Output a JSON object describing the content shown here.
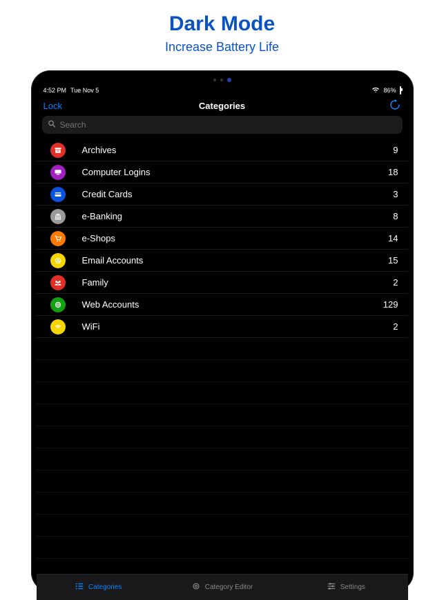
{
  "promo": {
    "title": "Dark Mode",
    "subtitle": "Increase Battery Life"
  },
  "status": {
    "time": "4:52 PM",
    "date": "Tue Nov 5",
    "battery_pct": "86%"
  },
  "nav": {
    "left": "Lock",
    "title": "Categories",
    "right_icon": "refresh"
  },
  "search": {
    "placeholder": "Search",
    "value": ""
  },
  "categories": [
    {
      "icon": "archive",
      "color": "#e22f27",
      "label": "Archives",
      "count": 9
    },
    {
      "icon": "computer",
      "color": "#a020c0",
      "label": "Computer Logins",
      "count": 18
    },
    {
      "icon": "card",
      "color": "#0a52e0",
      "label": "Credit Cards",
      "count": 3
    },
    {
      "icon": "bank",
      "color": "#9a9a9a",
      "label": "e-Banking",
      "count": 8
    },
    {
      "icon": "cart",
      "color": "#ff7a00",
      "label": "e-Shops",
      "count": 14
    },
    {
      "icon": "at",
      "color": "#f5d400",
      "label": "Email Accounts",
      "count": 15
    },
    {
      "icon": "family",
      "color": "#e22f27",
      "label": "Family",
      "count": 2
    },
    {
      "icon": "globe",
      "color": "#12a012",
      "label": "Web Accounts",
      "count": 129
    },
    {
      "icon": "wifi",
      "color": "#f5d400",
      "label": "WiFi",
      "count": 2
    }
  ],
  "tabs": [
    {
      "icon": "list",
      "label": "Categories",
      "active": true
    },
    {
      "icon": "gear",
      "label": "Category Editor",
      "active": false
    },
    {
      "icon": "sliders",
      "label": "Settings",
      "active": false
    }
  ]
}
